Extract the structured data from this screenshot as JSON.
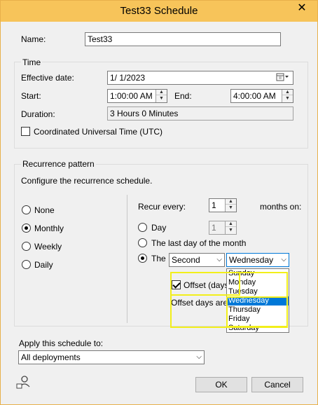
{
  "window": {
    "title": "Test33 Schedule",
    "close_glyph": "✕"
  },
  "name_field": {
    "label": "Name:",
    "value": "Test33"
  },
  "time_group": {
    "title": "Time",
    "effective_date_label": "Effective date:",
    "effective_date_value": "1/  1/2023",
    "start_label": "Start:",
    "start_value": "1:00:00 AM",
    "end_label": "End:",
    "end_value": "4:00:00 AM",
    "duration_label": "Duration:",
    "duration_value": "3 Hours 0 Minutes",
    "utc_label": "Coordinated Universal Time (UTC)",
    "utc_checked": false
  },
  "recurrence": {
    "title": "Recurrence pattern",
    "description": "Configure the recurrence schedule.",
    "options": [
      {
        "label": "None",
        "checked": false
      },
      {
        "label": "Monthly",
        "checked": true
      },
      {
        "label": "Weekly",
        "checked": false
      },
      {
        "label": "Daily",
        "checked": false
      }
    ],
    "recur_every_label": "Recur every:",
    "recur_every_value": "1",
    "months_on_label": "months on:",
    "day_label": "Day",
    "day_value": "1",
    "last_day_label": "The last day of the month",
    "the_label": "The",
    "ordinal_value": "Second",
    "weekday_value": "Wednesday",
    "weekday_options": [
      "Sunday",
      "Monday",
      "Tuesday",
      "Wednesday",
      "Thursday",
      "Friday",
      "Saturday"
    ],
    "selected_weekday_index": 3,
    "offset_label": "Offset (days)",
    "offset_checked": true,
    "offset_note": "Offset days are s"
  },
  "apply": {
    "label": "Apply this schedule to:",
    "value": "All deployments"
  },
  "buttons": {
    "ok": "OK",
    "cancel": "Cancel"
  },
  "icons": {
    "close": "close-icon",
    "calendar": "calendar-icon",
    "help": "user-help-icon"
  },
  "colors": {
    "titlebar": "#f7c45a",
    "selection": "#0078d7",
    "highlight": "#f2ef1a"
  }
}
